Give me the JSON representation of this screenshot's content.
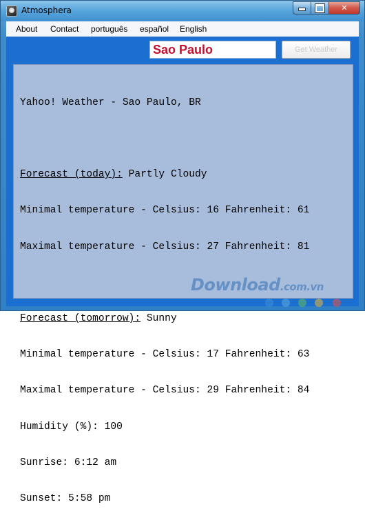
{
  "window": {
    "title": "Atmosphera",
    "min_glyph": "",
    "max_glyph": "",
    "close_glyph": "✕"
  },
  "menu": {
    "items": [
      "About",
      "Contact",
      "português",
      "español",
      "English"
    ]
  },
  "search": {
    "city_value": "Sao Paulo",
    "button_label": "Get Weather"
  },
  "report": {
    "header": "Yahoo! Weather - Sao Paulo, BR",
    "today_label": "Forecast (today):",
    "today_condition": " Partly Cloudy",
    "today_min": "Minimal temperature - Celsius: 16 Fahrenheit: 61",
    "today_max": "Maximal temperature - Celsius: 27 Fahrenheit: 81",
    "tomorrow_label": "Forecast (tomorrow):",
    "tomorrow_condition": " Sunny",
    "tomorrow_min": "Minimal temperature - Celsius: 17 Fahrenheit: 63",
    "tomorrow_max": "Maximal temperature - Celsius: 29 Fahrenheit: 84",
    "humidity": "Humidity (%): 100",
    "sunrise": "Sunrise: 6:12 am",
    "sunset": "Sunset: 5:58 pm"
  },
  "watermark": {
    "text": "Download",
    "domain": ".com.vn",
    "dot_colors": [
      "#3b8ed8",
      "#5aa6e0",
      "#58b86a",
      "#e0b040",
      "#d9534f"
    ]
  },
  "colors": {
    "city_text": "#c8102e",
    "client_background": "#1b6fd0",
    "panel_background": "#a8bcdb"
  }
}
